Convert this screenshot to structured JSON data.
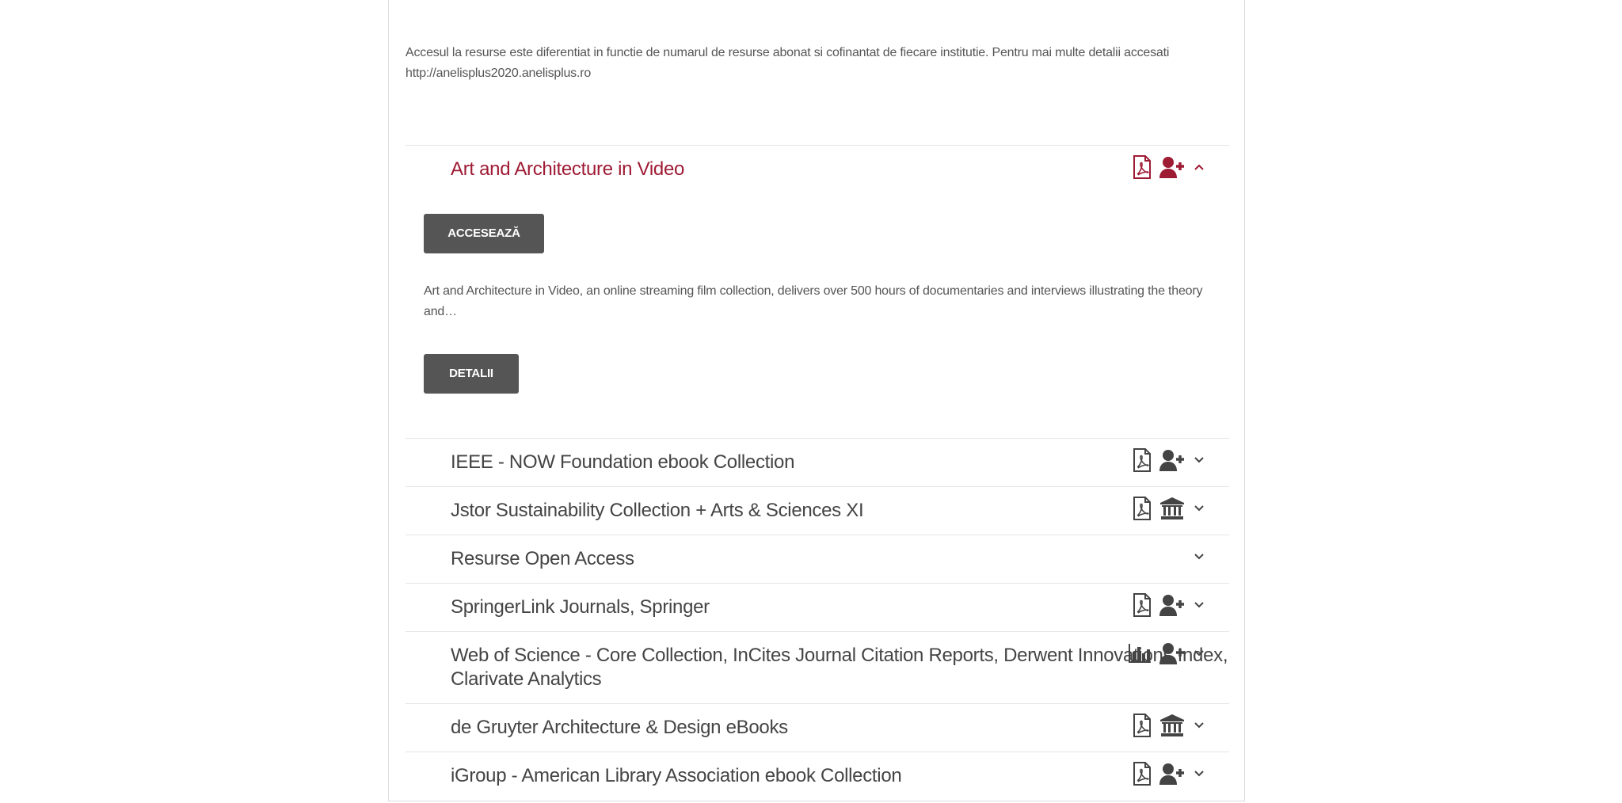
{
  "notice": {
    "line1": "Accesul la resurse este diferentiat in functie de numarul de resurse abonat si cofinantat de fiecare institutie. Pentru mai multe detalii accesati",
    "line2": "http://anelisplus2020.anelisplus.ro"
  },
  "expanded": {
    "title": "Art and Architecture in Video",
    "access_label": "ACCESEAZĂ",
    "desc_line1": "Art and Architecture in Video, an online streaming film collection, delivers over 500 hours of documentaries and interviews illustrating the theory",
    "desc_line2": "and…",
    "details_label": "DETALII"
  },
  "items": [
    {
      "title": "IEEE - NOW Foundation ebook Collection"
    },
    {
      "title": "Jstor Sustainability Collection + Arts & Sciences XI"
    },
    {
      "title": "Resurse Open Access"
    },
    {
      "title": "SpringerLink Journals, Springer"
    },
    {
      "title_line1": "Web of Science - Core Collection, InCites Journal Citation Reports, Derwent Innovations Index,",
      "title_line2": "Clarivate Analytics"
    },
    {
      "title": "de Gruyter Architecture & Design eBooks"
    },
    {
      "title": "iGroup - American Library Association ebook Collection"
    }
  ],
  "colors": {
    "accent": "#9e1b34",
    "text": "#444444",
    "button": "#555555"
  },
  "icons": [
    "pdf-icon",
    "user-plus-icon",
    "institution-icon",
    "bar-chart-icon",
    "chevron-up-icon",
    "chevron-down-icon"
  ]
}
